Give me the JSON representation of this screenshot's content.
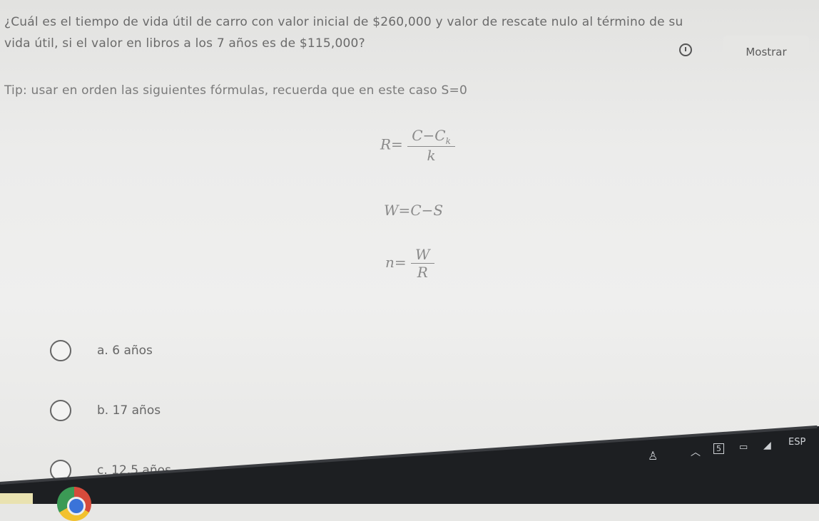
{
  "question": {
    "line1": "¿Cuál es el tiempo de vida útil de carro con valor inicial de $260,000 y valor de rescate nulo al término de su",
    "line2": "vida útil, si el valor en libros a los 7 años es de $115,000?"
  },
  "show_button": {
    "label": "Mostrar"
  },
  "tip": {
    "text": "Tip: usar en orden las siguientes fórmulas, recuerda que en este caso S=0"
  },
  "formulas": {
    "f1": {
      "lhs": "R=",
      "num": "C−C",
      "num_sub": "k",
      "den": "k"
    },
    "f2": {
      "text": "W=C−S"
    },
    "f3": {
      "lhs": "n=",
      "num": "W",
      "den": "R"
    }
  },
  "options": [
    {
      "label": "a.  6 años"
    },
    {
      "label": "b.  17 años"
    },
    {
      "label": "c.  12.5 años"
    }
  ],
  "taskbar": {
    "tray_language": "ESP",
    "tray_badge": "5"
  }
}
